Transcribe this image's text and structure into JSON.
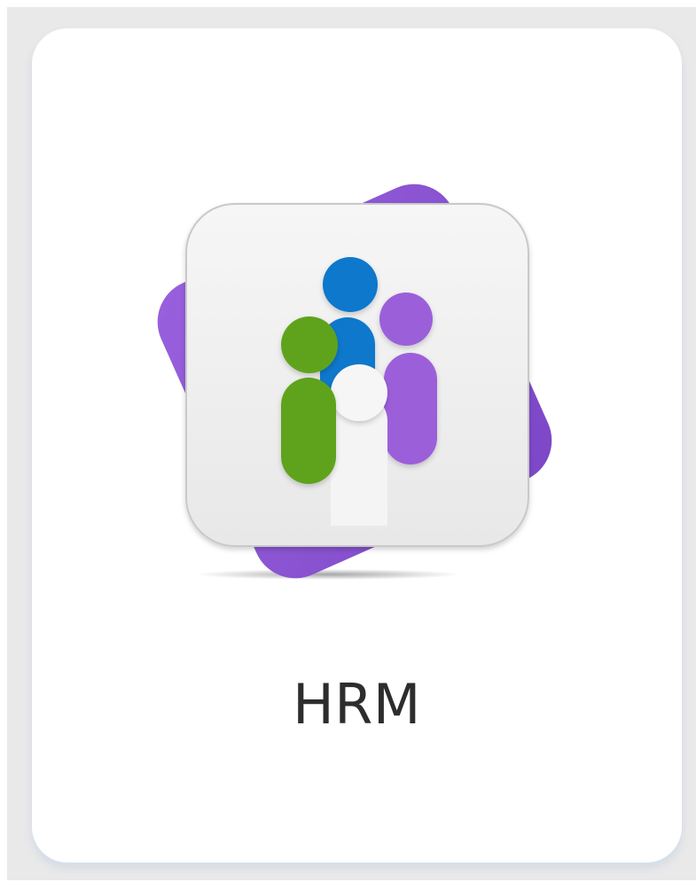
{
  "app": {
    "name": "HRM",
    "icon": "hrm-people-logo-icon"
  },
  "colors": {
    "background": "#e9e9ea",
    "card": "#ffffff",
    "label": "#2d2d2d",
    "backdrop_purple": "#8f55d6",
    "tile": "#f3f3f3",
    "person_green": "#5ea31f",
    "person_blue": "#0a78cc",
    "person_purple": "#9c5fda",
    "person_white": "#f6f6f6"
  }
}
